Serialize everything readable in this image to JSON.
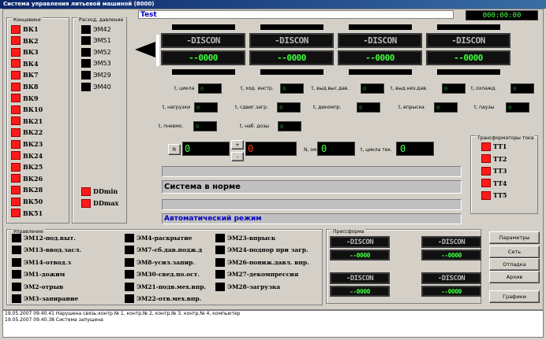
{
  "window": {
    "title": "Система управления литьевой машиной (8000)"
  },
  "test_label": "Test",
  "top_display": "000:00:00",
  "endswitches": {
    "title": "Концевики",
    "items": [
      "ВК1",
      "ВК2",
      "ВК3",
      "ВК4",
      "ВК7",
      "ВК8",
      "ВК9",
      "ВК10",
      "ВК21",
      "ВК22",
      "ВК23",
      "ВК24",
      "ВК25",
      "ВК26",
      "ВК28",
      "ВК50",
      "ВК51"
    ]
  },
  "flow": {
    "title": "Расход, давление",
    "items": [
      "ЭМ42",
      "ЭМ51",
      "ЭМ52",
      "ЭМ53",
      "ЭМ29",
      "ЭМ40"
    ],
    "pressure_items": [
      "DDmin",
      "DDmax"
    ]
  },
  "channels": [
    {
      "status": "-DISCON",
      "value": "--0000"
    },
    {
      "status": "-DISCON",
      "value": "--0000"
    },
    {
      "status": "-DISCON",
      "value": "--0000"
    },
    {
      "status": "-DISCON",
      "value": "--0000"
    }
  ],
  "params": [
    {
      "label": "t, цикла",
      "value": "0"
    },
    {
      "label": "t, ход. инстр.",
      "value": "0"
    },
    {
      "label": "t, выд.выс.дав.",
      "value": "0"
    },
    {
      "label": "t, выд.низ.дав.",
      "value": "0"
    },
    {
      "label": "t, охлажд.",
      "value": "0"
    },
    {
      "label": "t, нагрузки",
      "value": "0"
    },
    {
      "label": "t, сдвиг.загр.",
      "value": "0"
    },
    {
      "label": "t, декомпр.",
      "value": "0"
    },
    {
      "label": "t, впрыска",
      "value": "0"
    },
    {
      "label": "t, паузы",
      "value": "0"
    },
    {
      "label": "t, пневмо.",
      "value": "0"
    },
    {
      "label": "t, наб. дозы",
      "value": "0"
    }
  ],
  "counter": {
    "reset_label": "R",
    "value": "0",
    "red_value": "0",
    "up_label": "+",
    "down_label": "-",
    "n_label": "N, ом",
    "n_value": "0",
    "cycle_label": "t, цикла тек.",
    "cycle_value": "0"
  },
  "system_status": "Система в норме",
  "mode_status": "Автоматический режим",
  "transformers": {
    "title": "Трансформаторы тока",
    "items": [
      "ТТ1",
      "ТТ2",
      "ТТ3",
      "ТТ4",
      "ТТ5"
    ]
  },
  "control": {
    "title": "Управление",
    "col1": [
      "ЭМ12-под.выт.",
      "ЭМ13-ввод.засл.",
      "ЭМ14-отвод.з",
      "ЭМ1-дожим",
      "ЭМ2-отрыв",
      "ЭМ3-запирание"
    ],
    "col2": [
      "ЭМ4-раскрытие",
      "ЭМ7-сб.дав.подж.д",
      "ЭМ8-усил.запир.",
      "ЭМ30-свед.по.ост.",
      "ЭМ21-подв.мех.впр.",
      "ЭМ22-отв.мех.впр."
    ],
    "col3": [
      "ЭМ23-впрыск",
      "ЭМ24-подпор при загр.",
      "ЭМ26-пониж.давл. впр.",
      "ЭМ27-декомпрессия",
      "ЭМ28-загрузка"
    ]
  },
  "press_form": {
    "title": "Прессформа",
    "units": [
      {
        "status": "-DISCON",
        "value": "--0000"
      },
      {
        "status": "-DISCON",
        "value": "--0000"
      },
      {
        "status": "-DISCON",
        "value": "--0000"
      },
      {
        "status": "-DISCON",
        "value": "--0000"
      }
    ]
  },
  "buttons": {
    "params": "Параметры",
    "network": "Сеть",
    "debug": "Отладка",
    "archive": "Архив",
    "graphs": "Графики"
  },
  "log": [
    "19.05.2007 09.40.41 Нарушена связь:контр.№ 1, контр.№ 2, контр.№ 3, контр.№ 4, компьютер",
    "19.05.2007 09.40.38 Система запущена"
  ],
  "colors": {
    "led_on": "#ff1a1a",
    "led_off": "#000000",
    "title_blue": "#0a246a",
    "lcd_green": "#4aff4a"
  }
}
